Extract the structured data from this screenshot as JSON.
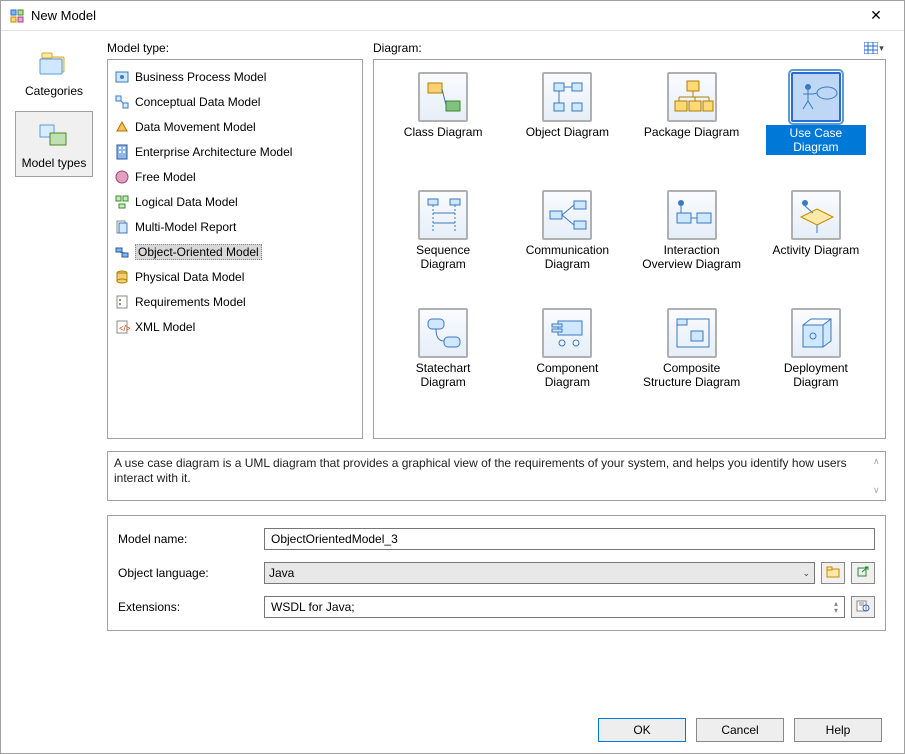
{
  "window": {
    "title": "New Model",
    "close_glyph": "✕"
  },
  "left_nav": {
    "categories_label": "Categories",
    "model_types_label": "Model types"
  },
  "labels": {
    "model_type": "Model type:",
    "diagram": "Diagram:"
  },
  "model_types": [
    "Business Process Model",
    "Conceptual Data Model",
    "Data Movement Model",
    "Enterprise Architecture Model",
    "Free Model",
    "Logical Data Model",
    "Multi-Model Report",
    "Object-Oriented Model",
    "Physical Data Model",
    "Requirements Model",
    "XML Model"
  ],
  "model_type_selected_index": 7,
  "diagrams": [
    "Class Diagram",
    "Object Diagram",
    "Package Diagram",
    "Use Case Diagram",
    "Sequence Diagram",
    "Communication Diagram",
    "Interaction Overview Diagram",
    "Activity Diagram",
    "Statechart Diagram",
    "Component Diagram",
    "Composite Structure Diagram",
    "Deployment Diagram"
  ],
  "diagram_selected_index": 3,
  "description": "A use case diagram is a UML diagram that provides a graphical view of the requirements of your system, and helps you identify how users interact with it.",
  "form": {
    "model_name_label": "Model name:",
    "model_name_value": "ObjectOrientedModel_3",
    "object_language_label": "Object language:",
    "object_language_value": "Java",
    "extensions_label": "Extensions:",
    "extensions_value": "WSDL for Java;"
  },
  "buttons": {
    "ok": "OK",
    "cancel": "Cancel",
    "help": "Help"
  }
}
